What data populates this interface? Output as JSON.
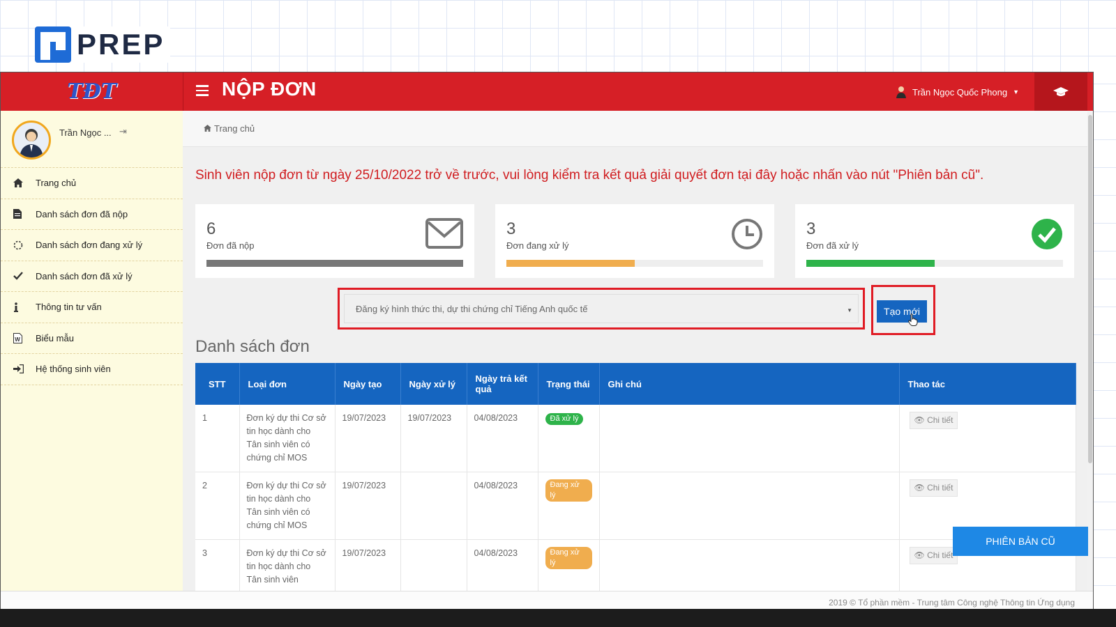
{
  "brand": {
    "name": "PREP"
  },
  "app": {
    "logo_text": "TĐT",
    "page_title": "NỘP ĐƠN",
    "user_full": "Trần Ngọc Quốc Phong"
  },
  "sidebar": {
    "user_short": "Trần Ngọc ...",
    "items": [
      {
        "label": "Trang chủ",
        "icon": "home-icon"
      },
      {
        "label": "Danh sách đơn đã nộp",
        "icon": "file-icon"
      },
      {
        "label": "Danh sách đơn đang xử lý",
        "icon": "spinner-icon"
      },
      {
        "label": "Danh sách đơn đã xử lý",
        "icon": "check-icon"
      },
      {
        "label": "Thông tin tư vấn",
        "icon": "info-icon"
      },
      {
        "label": "Biểu mẫu",
        "icon": "word-doc-icon"
      },
      {
        "label": "Hệ thống sinh viên",
        "icon": "sign-in-icon"
      }
    ]
  },
  "breadcrumb": {
    "home": "Trang chủ"
  },
  "notice": {
    "text": "Sinh viên nộp đơn từ ngày 25/10/2022 trở về trước, vui lòng kiểm tra kết quả giải quyết đơn ",
    "link": "tại đây",
    "text2": " hoặc nhấn vào nút \"Phiên bản cũ\"."
  },
  "stats": [
    {
      "count": "6",
      "label": "Đơn đã nộp",
      "fraction": 1.0,
      "color": "#777777"
    },
    {
      "count": "3",
      "label": "Đơn đang xử lý",
      "fraction": 0.5,
      "color": "#f0ad4e"
    },
    {
      "count": "3",
      "label": "Đơn đã xử lý",
      "fraction": 0.5,
      "color": "#2eb34a"
    }
  ],
  "form": {
    "selected_type": "Đăng ký hình thức thi, dự thi chứng chỉ Tiếng Anh quốc tế",
    "create_label": "Tạo mới"
  },
  "list": {
    "title": "Danh sách đơn",
    "headers": [
      "STT",
      "Loại đơn",
      "Ngày tạo",
      "Ngày xử lý",
      "Ngày trả kết quả",
      "Trạng thái",
      "Ghi chú",
      "Thao tác"
    ],
    "rows": [
      {
        "stt": "1",
        "type": "Đơn ký dự thi Cơ sở tin học dành cho Tân sinh viên có chứng chỉ MOS",
        "created": "19/07/2023",
        "processed": "19/07/2023",
        "result": "04/08/2023",
        "status": "Đã xử lý",
        "status_color": "#2eb34a",
        "note": "",
        "action": "Chi tiết"
      },
      {
        "stt": "2",
        "type": "Đơn ký dự thi Cơ sở tin học dành cho Tân sinh viên có chứng chỉ MOS",
        "created": "19/07/2023",
        "processed": "",
        "result": "04/08/2023",
        "status": "Đang xử lý",
        "status_color": "#f0ad4e",
        "note": "",
        "action": "Chi tiết"
      },
      {
        "stt": "3",
        "type": "Đơn ký dự thi Cơ sở tin học dành cho Tân sinh viên",
        "created": "19/07/2023",
        "processed": "",
        "result": "04/08/2023",
        "status": "Đang xử lý",
        "status_color": "#f0ad4e",
        "note": "",
        "action": "Chi tiết"
      }
    ]
  },
  "old_version_button": "PHIÊN BẢN CŨ",
  "footer": "2019 © Tổ phần mềm - Trung tâm Công nghệ Thông tin Ứng dụng"
}
